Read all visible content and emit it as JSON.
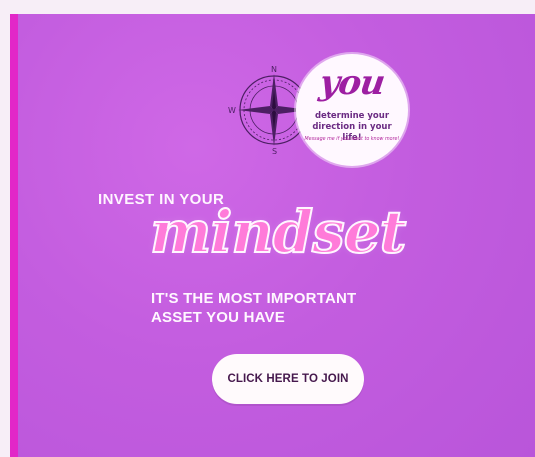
{
  "banner": {
    "compass_label_n": "N",
    "compass_label_s": "S",
    "compass_label_w": "W",
    "you": {
      "word": "you",
      "line1": "determine your",
      "line2": "direction in your life!",
      "tiny": "Message me if you want to know more!"
    },
    "headline_small": "INVEST IN YOUR",
    "headline_big": "mindset",
    "subline1": "IT'S THE MOST IMPORTANT",
    "subline2": "ASSET YOU HAVE",
    "cta_label": "CLICK HERE TO JOIN"
  },
  "colors": {
    "page_bg": "#f7eef7",
    "banner_bg": "#c35ddf",
    "accent_stripe": "#e227c8",
    "mindset_fill": "#ff7bd9",
    "button_text": "#46184d"
  }
}
